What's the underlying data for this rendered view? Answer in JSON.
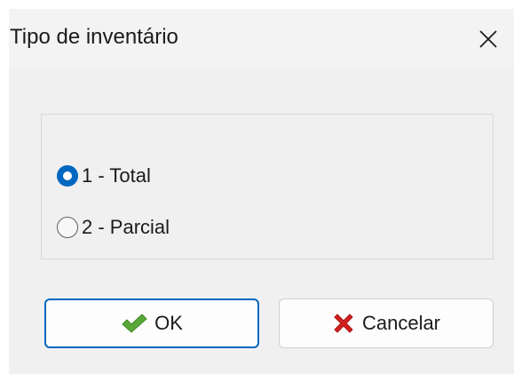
{
  "dialog": {
    "title": "Tipo de inventário",
    "close_icon": "close-icon"
  },
  "options": [
    {
      "label": "1 - Total",
      "checked": true
    },
    {
      "label": "2 - Parcial",
      "checked": false
    }
  ],
  "buttons": {
    "ok_label": "OK",
    "ok_icon": "checkmark-icon",
    "cancel_label": "Cancelar",
    "cancel_icon": "red-x-icon"
  },
  "colors": {
    "accent": "#0067c0",
    "check_green": "#5aa83a",
    "cancel_red": "#d42020"
  }
}
